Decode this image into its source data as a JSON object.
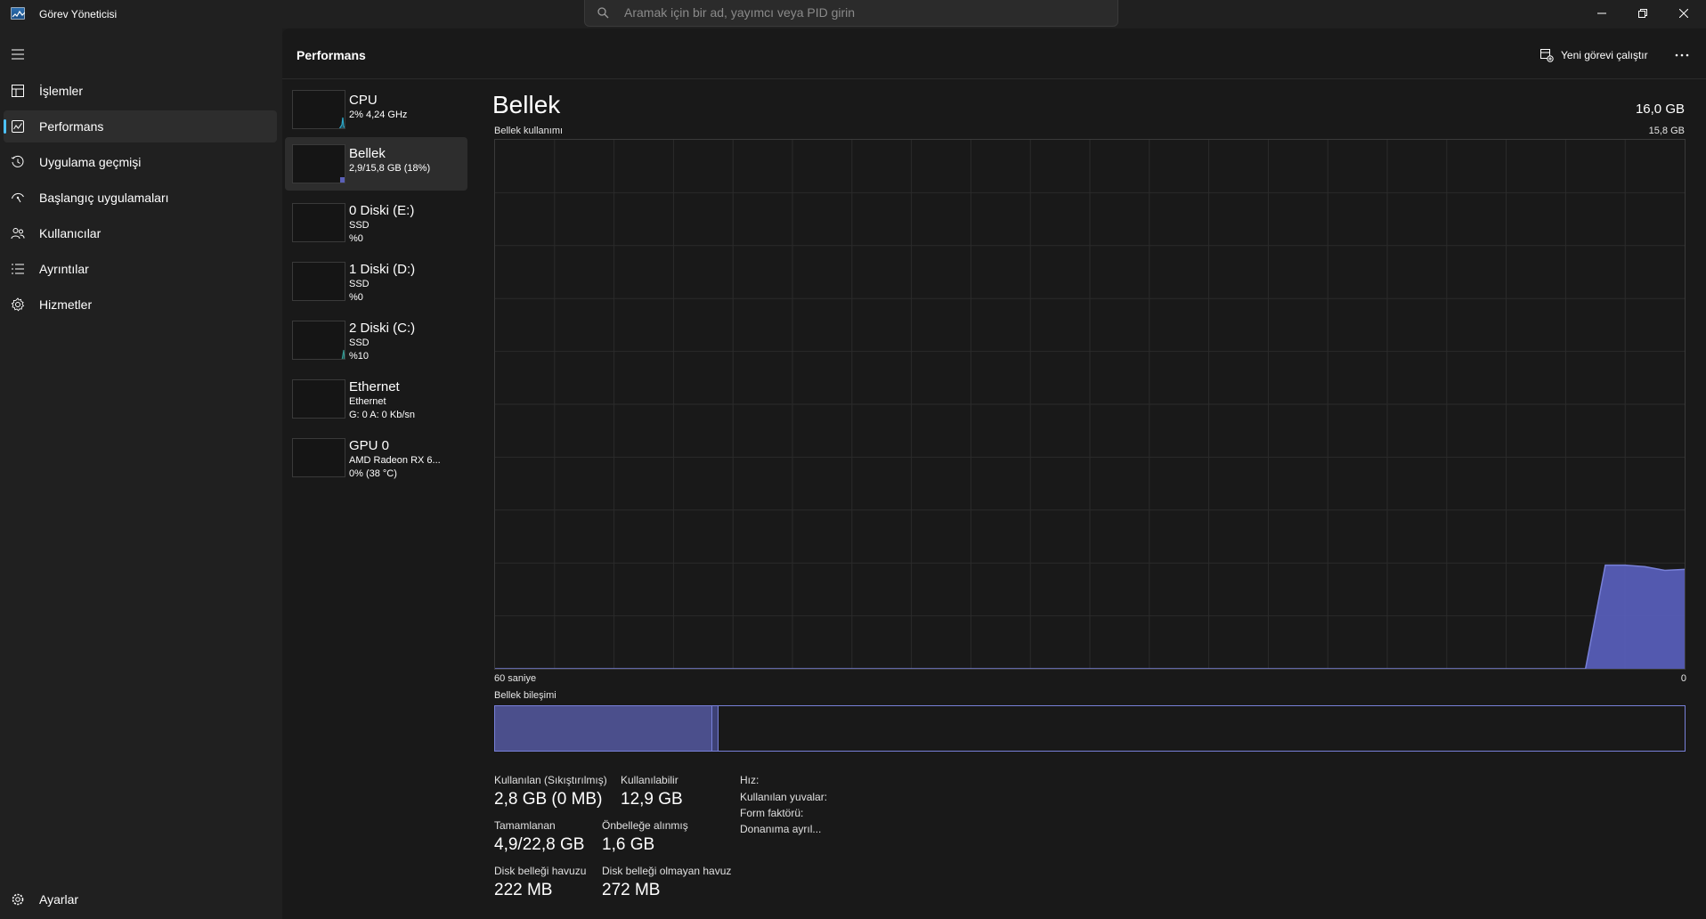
{
  "app": {
    "title": "Görev Yöneticisi",
    "search_placeholder": "Aramak için bir ad, yayımcı veya PID girin"
  },
  "sidebar": {
    "items": [
      {
        "label": "İşlemler",
        "icon": "processes-icon"
      },
      {
        "label": "Performans",
        "icon": "performance-icon",
        "active": true
      },
      {
        "label": "Uygulama geçmişi",
        "icon": "history-icon"
      },
      {
        "label": "Başlangıç uygulamaları",
        "icon": "startup-icon"
      },
      {
        "label": "Kullanıcılar",
        "icon": "users-icon"
      },
      {
        "label": "Ayrıntılar",
        "icon": "details-icon"
      },
      {
        "label": "Hizmetler",
        "icon": "services-icon"
      }
    ],
    "settings_label": "Ayarlar"
  },
  "header": {
    "title": "Performans",
    "run_task_label": "Yeni görevi çalıştır"
  },
  "resources": [
    {
      "name": "CPU",
      "lines": [
        "2% 4,24 GHz"
      ],
      "color": "#2ea8c8"
    },
    {
      "name": "Bellek",
      "lines": [
        "2,9/15,8 GB (18%)"
      ],
      "color": "#7880d8",
      "active": true
    },
    {
      "name": "0 Diski (E:)",
      "lines": [
        "SSD",
        "%0"
      ],
      "color": "#3aa09a"
    },
    {
      "name": "1 Diski (D:)",
      "lines": [
        "SSD",
        "%0"
      ],
      "color": "#3aa09a"
    },
    {
      "name": "2 Diski (C:)",
      "lines": [
        "SSD",
        "%10"
      ],
      "color": "#3aa09a"
    },
    {
      "name": "Ethernet",
      "lines": [
        "Ethernet",
        "G: 0 A: 0 Kb/sn"
      ],
      "color": "#b0557a"
    },
    {
      "name": "GPU 0",
      "lines": [
        "AMD Radeon RX 6...",
        "0% (38 °C)"
      ],
      "color": "#4a6bc9"
    }
  ],
  "detail": {
    "title": "Bellek",
    "total": "16,0 GB",
    "usage_label": "Bellek kullanımı",
    "max_label": "15,8 GB",
    "time_left": "60 saniye",
    "time_right": "0",
    "composition_label": "Bellek bileşimi",
    "usage_fraction": 0.18,
    "usage_history": [
      0,
      0,
      0,
      0,
      0,
      0,
      0,
      0,
      0,
      0,
      0,
      0,
      0,
      0,
      0,
      0,
      0,
      0,
      0,
      0,
      0,
      0,
      0,
      0,
      0,
      0,
      0,
      0,
      0,
      0,
      0,
      0,
      0,
      0,
      0,
      0,
      0,
      0,
      0,
      0,
      0,
      0,
      0,
      0,
      0,
      0,
      0,
      0,
      0,
      0,
      0,
      0,
      0,
      0,
      0,
      0,
      0.196,
      0.196,
      0.193,
      0.186,
      0.188
    ],
    "chart_color": "#7880d8",
    "stats": [
      {
        "label": "Kullanılan (Sıkıştırılmış)",
        "value": "2,8 GB (0 MB)"
      },
      {
        "label": "Kullanılabilir",
        "value": "12,9 GB"
      },
      {
        "label": "Tamamlanan",
        "value": "4,9/22,8 GB"
      },
      {
        "label": "Önbelleğe alınmış",
        "value": "1,6 GB"
      },
      {
        "label": "Disk belleği havuzu",
        "value": "222 MB"
      },
      {
        "label": "Disk belleği olmayan havuz",
        "value": "272 MB"
      }
    ],
    "props": [
      "Hız:",
      "Kullanılan yuvalar:",
      "Form faktörü:",
      "Donanıma ayrıl..."
    ]
  }
}
